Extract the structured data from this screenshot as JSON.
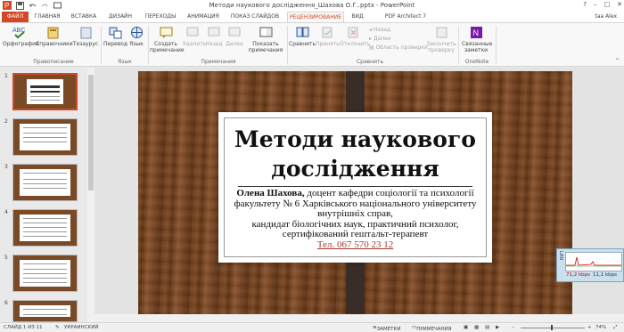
{
  "window": {
    "title": "Методи наукового дослідження_Шахова О.Г..pptx - PowerPoint",
    "help": "?",
    "controls": [
      "–",
      "□",
      "✕"
    ]
  },
  "qat": {
    "save_icon": "save-icon",
    "undo_icon": "undo-icon",
    "redo_icon": "redo-icon",
    "present_icon": "slideshow-icon"
  },
  "tabs": [
    {
      "label": "ФАЙЛ"
    },
    {
      "label": "ГЛАВНАЯ"
    },
    {
      "label": "ВСТАВКА"
    },
    {
      "label": "ДИЗАЙН"
    },
    {
      "label": "ПЕРЕХОДЫ"
    },
    {
      "label": "АНИМАЦИЯ"
    },
    {
      "label": "ПОКАЗ СЛАЙДОВ"
    },
    {
      "label": "РЕЦЕНЗИРОВАНИЕ"
    },
    {
      "label": "ВИД"
    },
    {
      "label": "PDF Architect 7 Creator"
    }
  ],
  "user": "taa Alex",
  "ribbon": {
    "spelling": "Орфография",
    "thesaurus_ref": "Справочники",
    "thesaurus": "Тезаурус",
    "translate": "Перевод",
    "language": "Язык",
    "new_comment": "Создать примечание",
    "delete": "Удалить",
    "back": "Назад",
    "next": "Далее",
    "show_comments": "Показать примечания",
    "compare": "Сравнить",
    "accept": "Принять",
    "reject": "Отклонить",
    "prev_small": "Назад",
    "next_small": "Далее",
    "review_pane": "Область проверки",
    "end_review": "Закончить проверку",
    "linked_notes": "Связанные заметки",
    "groups": {
      "proofing": "Правописание",
      "language": "Язык",
      "comments": "Примечания",
      "compare": "Сравнить",
      "onenote": "OneNote"
    }
  },
  "thumbnails": [
    {
      "num": "1"
    },
    {
      "num": "2"
    },
    {
      "num": "3"
    },
    {
      "num": "4"
    },
    {
      "num": "5"
    },
    {
      "num": "6"
    }
  ],
  "slide": {
    "title": "Методи наукового дослідження",
    "author_name": "Олена Шахова,",
    "line1": " доцент кафедри соціології та психології факультету № 6 Харківського національного університету внутрішніх справ,",
    "line2": "кандидат біологічних наук, практичний психолог, сертифікований гештальт-терапевт",
    "phone": "Тел. 067 570 23 12"
  },
  "status": {
    "slide_info": "СЛАЙД 1 ИЗ 11",
    "language": "УКРАИНСКИЙ",
    "notes": "ЗАМЕТКИ",
    "comments": "ПРИМЕЧАНИЯ",
    "zoom": "74%"
  },
  "network": {
    "side_label": "LAN",
    "down": "71,2 kbps",
    "up": "11,1 kbps"
  }
}
